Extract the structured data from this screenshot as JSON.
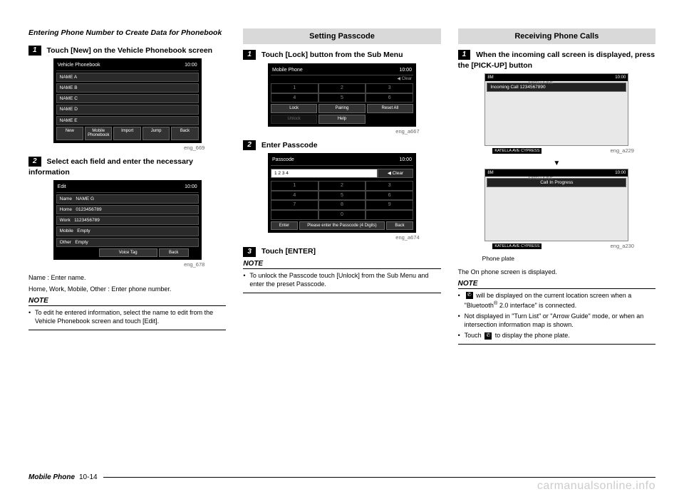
{
  "footer": {
    "section": "Mobile Phone",
    "page": "10-14"
  },
  "watermark": "carmanualsonline.info",
  "col1": {
    "subhead": "Entering Phone Number to Create Data for Phonebook",
    "step1": {
      "num": "1",
      "text": "Touch [New] on the Vehicle Phonebook screen"
    },
    "shot1": {
      "title": "Vehicle Phonebook",
      "time": "10:00",
      "rows": [
        "NAME A",
        "NAME B",
        "NAME C",
        "NAME D",
        "NAME E"
      ],
      "btns": [
        "New",
        "Mobile Phonebook",
        "Import",
        "Jump",
        "Back"
      ],
      "cap": "eng_669"
    },
    "step2": {
      "num": "2",
      "text": "Select each field and enter the necessary information"
    },
    "shot2": {
      "title": "Edit",
      "time": "10:00",
      "rows": [
        [
          "Name",
          "NAME G"
        ],
        [
          "Home",
          "0123456789"
        ],
        [
          "Work",
          "1123456789"
        ],
        [
          "Mobile",
          "Empty"
        ],
        [
          "Other",
          "Empty"
        ]
      ],
      "btns": [
        "Voice Tag",
        "Back"
      ],
      "cap": "eng_678"
    },
    "desc1": "Name : Enter name.",
    "desc2": "Home, Work, Mobile, Other : Enter phone number.",
    "note_head": "NOTE",
    "note1": "To edit he entered information, select the name to edit from the Vehicle Phonebook screen and touch [Edit]."
  },
  "col2": {
    "header": "Setting Passcode",
    "step1": {
      "num": "1",
      "text": "Touch [Lock] button from the Sub Menu"
    },
    "shot1": {
      "title": "Mobile Phone",
      "time": "10:00",
      "clear": "◀ Clear",
      "grid": [
        [
          "1",
          "2",
          "3"
        ],
        [
          "4",
          "5",
          "6"
        ]
      ],
      "btns1": [
        "Lock",
        "Pairing",
        "Reset All"
      ],
      "btns2": [
        "Unlock",
        "Help"
      ],
      "cap": "eng_a667"
    },
    "step2": {
      "num": "2",
      "text": "Enter Passcode"
    },
    "shot2": {
      "title": "Passcode",
      "time": "10:00",
      "entry": "1  2  3  4",
      "clear": "◀ Clear",
      "grid": [
        [
          "1",
          "2",
          "3"
        ],
        [
          "4",
          "5",
          "6"
        ],
        [
          "7",
          "8",
          "9"
        ],
        [
          "",
          "0",
          ""
        ]
      ],
      "footer_l": "Enter",
      "footer_m": "Please enter the Passcode (4 Digits)",
      "footer_r": "Back",
      "cap": "eng_a674"
    },
    "step3": {
      "num": "3",
      "text": "Touch [ENTER]"
    },
    "note_head": "NOTE",
    "note1": "To unlock the Passcode touch [Unlock] from the Sub Menu and enter the preset Passcode."
  },
  "col3": {
    "header": "Receiving Phone Calls",
    "step1": {
      "num": "1",
      "text": "When the incoming call screen is displayed, press the [PICK-UP] button"
    },
    "map1": {
      "top_l": "8M",
      "top_r": "10:00",
      "callbar": "Incoming Call   1234567890",
      "street1": "KATELLA AVE",
      "street2": "KATELLA AVE CYPRESS",
      "cap": "eng_a229"
    },
    "arrow": "▼",
    "map2": {
      "top_l": "8M",
      "top_r": "10:00",
      "callbar": "Call In Progress",
      "street1": "KATELLA AVE",
      "street2": "KATELLA AVE CYPRESS",
      "cap": "eng_a230"
    },
    "plate_label": "Phone plate",
    "desc": "The On phone screen is displayed.",
    "note_head": "NOTE",
    "note1_a": " will be displayed on the current location screen when a \"Bluetooth",
    "note1_b": " 2.0 interface\" is connected.",
    "note2": "Not displayed in \"Turn List\" or \"Arrow Guide\" mode, or when an intersection information map is shown.",
    "note3_a": "Touch ",
    "note3_b": " to display the phone plate."
  }
}
